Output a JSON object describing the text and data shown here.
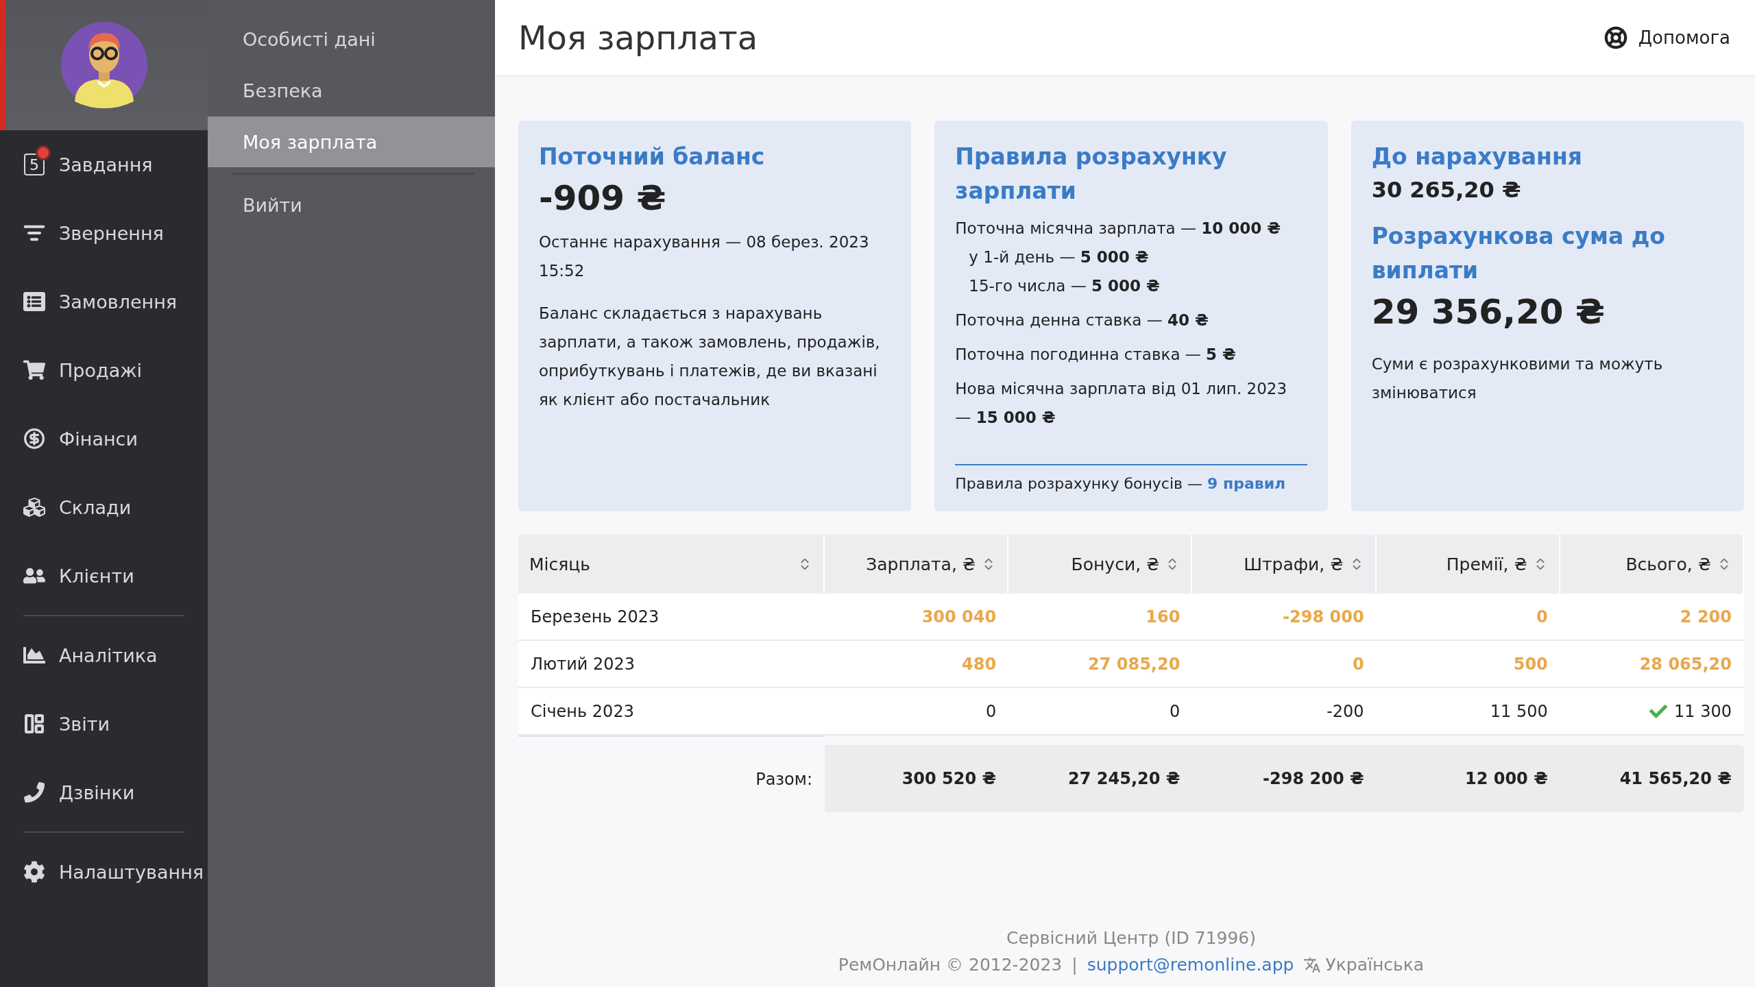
{
  "sidebar": {
    "items": [
      {
        "label": "Завдання",
        "badge": "5",
        "alert": true
      },
      {
        "label": "Звернення"
      },
      {
        "label": "Замовлення"
      },
      {
        "label": "Продажі"
      },
      {
        "label": "Фінанси"
      },
      {
        "label": "Склади"
      },
      {
        "label": "Клієнти",
        "divider_after": true
      },
      {
        "label": "Аналітика"
      },
      {
        "label": "Звіти"
      },
      {
        "label": "Дзвінки",
        "divider_after": true
      },
      {
        "label": "Налаштування"
      }
    ]
  },
  "submenu": {
    "items": [
      {
        "label": "Особисті дані",
        "selected": false
      },
      {
        "label": "Безпека",
        "selected": false
      },
      {
        "label": "Моя зарплата",
        "selected": true,
        "divider_after": true
      },
      {
        "label": "Вийти",
        "selected": false
      }
    ]
  },
  "header": {
    "title": "Моя зарплата",
    "help": "Допомога"
  },
  "cards": [
    {
      "title": "Поточний баланс",
      "value": "-909 ₴",
      "lines": [
        {
          "kind": "text",
          "text": "Останнє нарахування — 08 берез. 2023 15:52"
        },
        {
          "kind": "para",
          "text": "Баланс складається з нарахувань зарплати, а також замовлень, продажів, оприбуткувань і платежів, де ви вказані як клієнт або постачальник"
        }
      ]
    },
    {
      "title": "Правила розрахунку зарплати",
      "lines": [
        {
          "kind": "text",
          "text": "Поточна місячна зарплата — **10 000 ₴**"
        },
        {
          "kind": "sub",
          "text": "у 1-й день — **5 000 ₴**"
        },
        {
          "kind": "sub",
          "text": "15-го числа — **5 000 ₴**"
        },
        {
          "kind": "text",
          "text": "Поточна денна ставка — **40 ₴**"
        },
        {
          "kind": "text",
          "text": "Поточна погодинна ставка — **5 ₴**"
        },
        {
          "kind": "text",
          "text": "Нова місячна зарплата від 01 лип. 2023 — **15 000 ₴**"
        }
      ],
      "footer": {
        "text": "Правила розрахунку бонусів —",
        "link": "9 правил"
      }
    },
    {
      "title": "До нарахування",
      "subvalue": "30 265,20 ₴",
      "title2": "Розрахункова сума до виплати",
      "value": "29 356,20 ₴",
      "lines": [
        {
          "kind": "para",
          "text": "Суми є розрахунковими та можуть змінюватися"
        }
      ]
    }
  ],
  "table": {
    "columns": [
      "Місяць",
      "Зарплата, ₴",
      "Бонуси, ₴",
      "Штрафи, ₴",
      "Премії, ₴",
      "Всього, ₴"
    ],
    "rows": [
      {
        "kind": "pending",
        "cells": [
          "Березень 2023",
          "300 040",
          "160",
          "-298 000",
          "0",
          "2 200"
        ]
      },
      {
        "kind": "pending",
        "cells": [
          "Лютий 2023",
          "480",
          "27 085,20",
          "0",
          "500",
          "28 065,20"
        ]
      },
      {
        "kind": "paid",
        "cells": [
          "Січень 2023",
          "0",
          "0",
          "-200",
          "11 500",
          "11 300"
        ]
      }
    ],
    "totals": {
      "label": "Разом:",
      "cells": [
        "300 520 ₴",
        "27 245,20 ₴",
        "-298 200 ₴",
        "12 000 ₴",
        "41 565,20 ₴"
      ]
    }
  },
  "footer": {
    "company": "Сервісний Центр (ID 71996)",
    "copyright": "РемОнлайн © 2012-2023",
    "separator": "|",
    "email": "support@remonline.app",
    "language": "Українська"
  }
}
